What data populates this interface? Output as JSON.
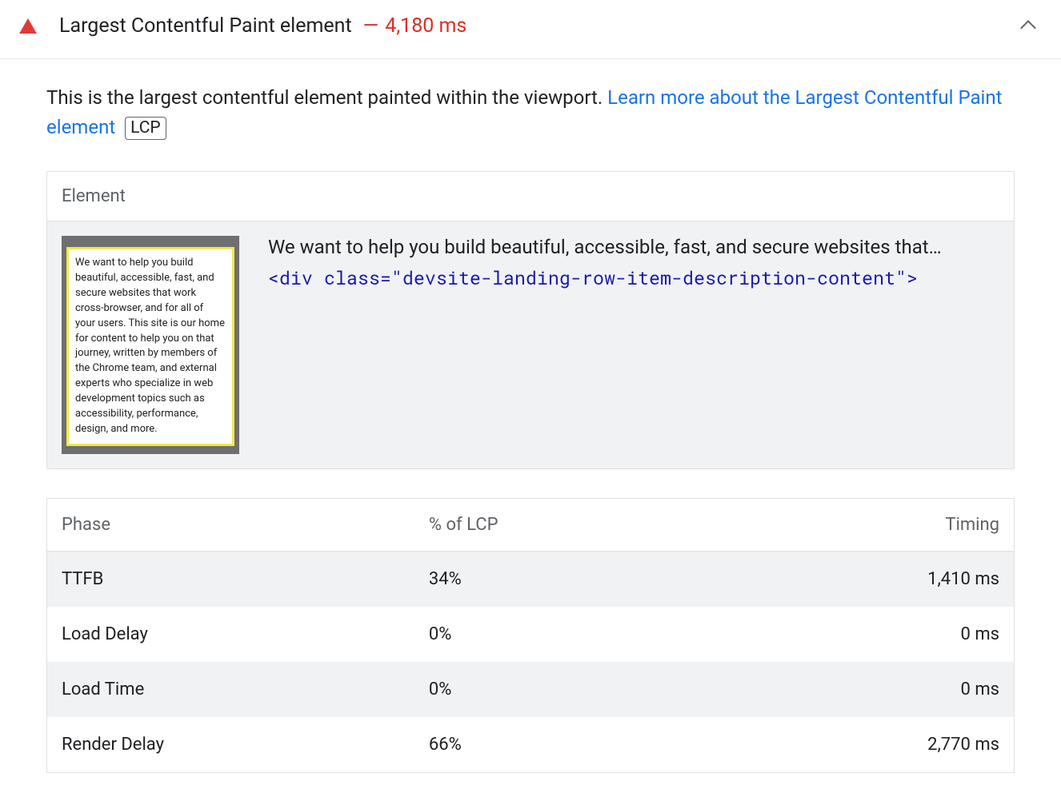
{
  "header": {
    "title": "Largest Contentful Paint element",
    "dash": "—",
    "value": "4,180 ms"
  },
  "description": {
    "intro": "This is the largest contentful element painted within the viewport. ",
    "link": "Learn more about the Largest Contentful Paint element",
    "badge": "LCP"
  },
  "element_panel": {
    "heading": "Element",
    "thumb_text": "We want to help you build beautiful, accessible, fast, and secure websites that work cross-browser, and for all of your users. This site is our home for content to help you on that journey, written by members of the Chrome team, and external experts who specialize in web development topics such as accessibility, performance, design, and more.",
    "snippet": "We want to help you build beautiful, accessible, fast, and secure websites that…",
    "code": "<div class=\"devsite-landing-row-item-description-content\">"
  },
  "phase_table": {
    "headers": {
      "phase": "Phase",
      "pct": "% of LCP",
      "timing": "Timing"
    },
    "rows": [
      {
        "phase": "TTFB",
        "pct": "34%",
        "timing": "1,410 ms"
      },
      {
        "phase": "Load Delay",
        "pct": "0%",
        "timing": "0 ms"
      },
      {
        "phase": "Load Time",
        "pct": "0%",
        "timing": "0 ms"
      },
      {
        "phase": "Render Delay",
        "pct": "66%",
        "timing": "2,770 ms"
      }
    ]
  }
}
